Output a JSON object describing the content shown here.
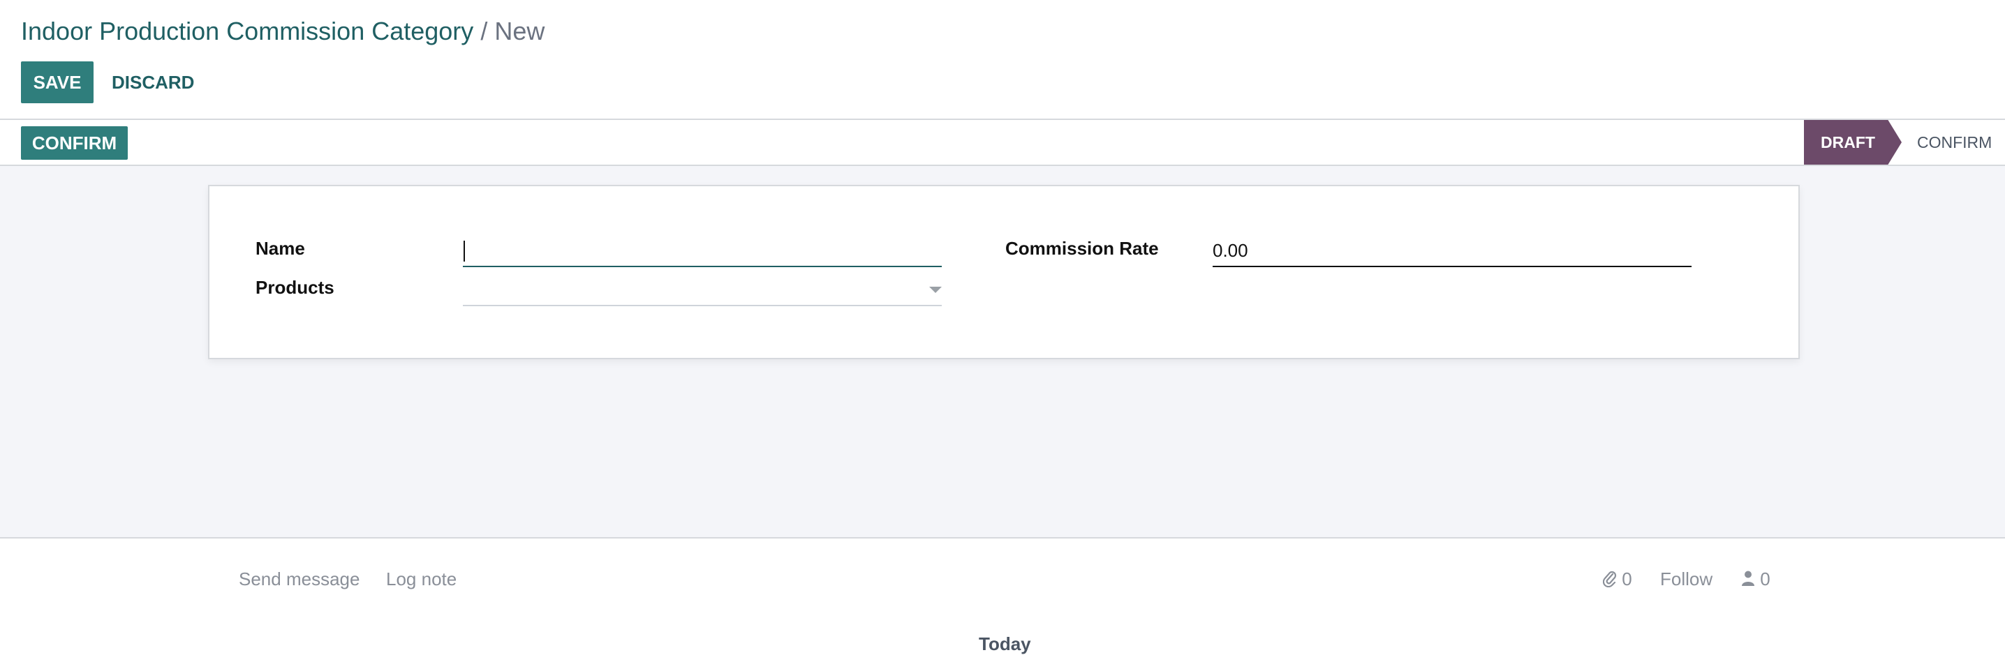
{
  "breadcrumb": {
    "parent": "Indoor Production Commission Category",
    "separator": "/",
    "current": "New"
  },
  "toolbar": {
    "save_label": "SAVE",
    "discard_label": "DISCARD"
  },
  "statusbar": {
    "confirm_button_label": "CONFIRM",
    "stages": [
      {
        "label": "DRAFT",
        "active": true
      },
      {
        "label": "CONFIRM",
        "active": false
      }
    ]
  },
  "form": {
    "name": {
      "label": "Name",
      "value": ""
    },
    "products": {
      "label": "Products",
      "value": ""
    },
    "commission_rate": {
      "label": "Commission Rate",
      "value": "0.00"
    }
  },
  "chatter": {
    "send_message_label": "Send message",
    "log_note_label": "Log note",
    "attachments_count": "0",
    "follow_label": "Follow",
    "followers_count": "0",
    "today_label": "Today"
  },
  "icons": {
    "attachment": "paperclip-icon",
    "followers": "user-icon",
    "dropdown": "caret-down-icon"
  },
  "colors": {
    "primary": "#2f7e7c",
    "breadcrumb_link": "#1f5f63",
    "active_stage": "#6c4a69",
    "sheet_background": "#f4f5f9"
  }
}
